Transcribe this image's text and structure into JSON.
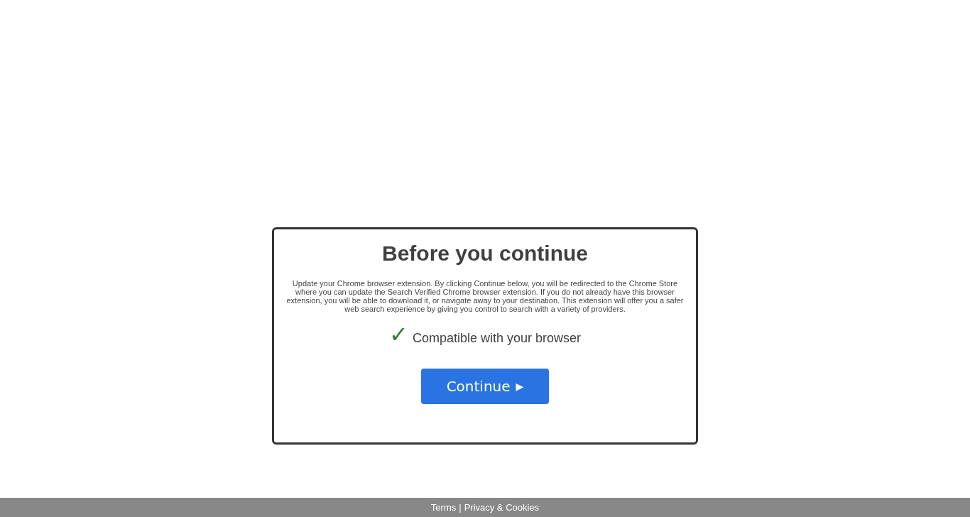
{
  "dialog": {
    "title": "Before you continue",
    "message": "Update your Chrome browser extension. By clicking Continue below, you will be redirected to the Chrome Store where you can update the Search Verified Chrome browser extension. If you do not already have this browser extension, you will be able to download it, or navigate away to your destination. This extension will offer you a safer web search experience by giving you control to search with a variety of providers.",
    "status": {
      "mark": "✓",
      "text": "Compatible with your browser"
    },
    "button": {
      "label": "Continue",
      "arrow": "▶"
    }
  },
  "footer": {
    "links": [
      "Terms",
      "Privacy & Cookies"
    ],
    "separator": "|"
  }
}
